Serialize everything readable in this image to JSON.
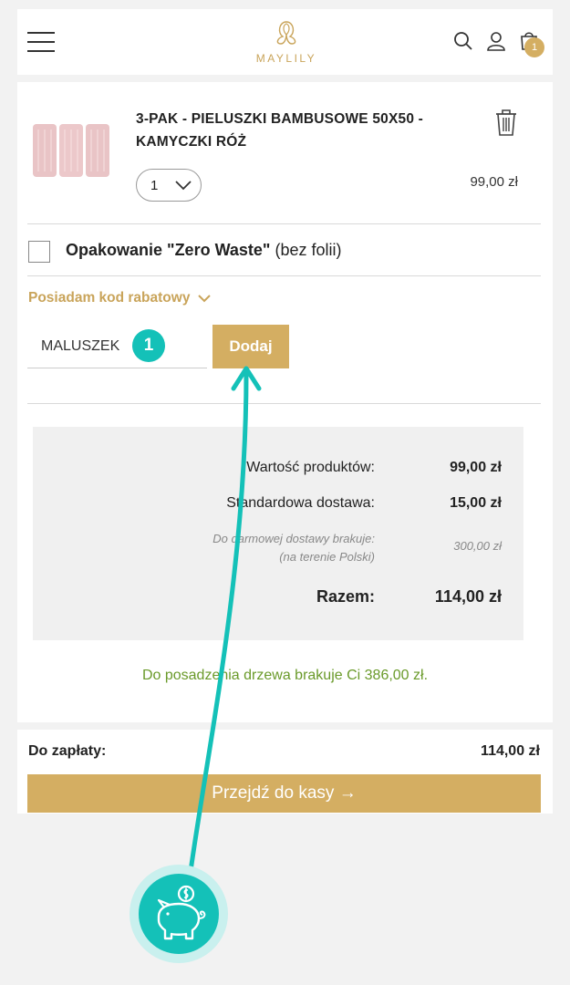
{
  "header": {
    "logo_text": "MAYLILY",
    "cart_count": "1"
  },
  "product": {
    "name_line1": "3-PAK - PIELUSZKI BAMBUSOWE 50X50 -",
    "name_line2": "KAMYCZKI RÓŻ",
    "quantity": "1",
    "price": "99,00 zł"
  },
  "options": {
    "zero_waste_bold": "Opakowanie \"Zero Waste\"",
    "zero_waste_rest": " (bez folii)",
    "discount_toggle": "Posiadam kod rabatowy"
  },
  "discount": {
    "code_value": "MALUSZEK",
    "step_number": "1",
    "add_label": "Dodaj"
  },
  "summary": {
    "products_label": "Wartość produktów:",
    "products_value": "99,00 zł",
    "shipping_label": "Standardowa dostawa:",
    "shipping_value": "15,00 zł",
    "free_shipping_line1": "Do darmowej dostawy brakuje:",
    "free_shipping_line2": "(na terenie Polski)",
    "free_shipping_value": "300,00 zł",
    "total_label": "Razem:",
    "total_value": "114,00 zł"
  },
  "tree_message": "Do posadzenia drzewa brakuje Ci 386,00 zł.",
  "footer": {
    "pay_label": "Do zapłaty:",
    "pay_value": "114,00 zł",
    "checkout_label": "Przejdź do kasy →"
  },
  "colors": {
    "brand_gold": "#d4ae62",
    "accent_teal": "#14c1b8",
    "tree_green": "#6a9a2a"
  }
}
